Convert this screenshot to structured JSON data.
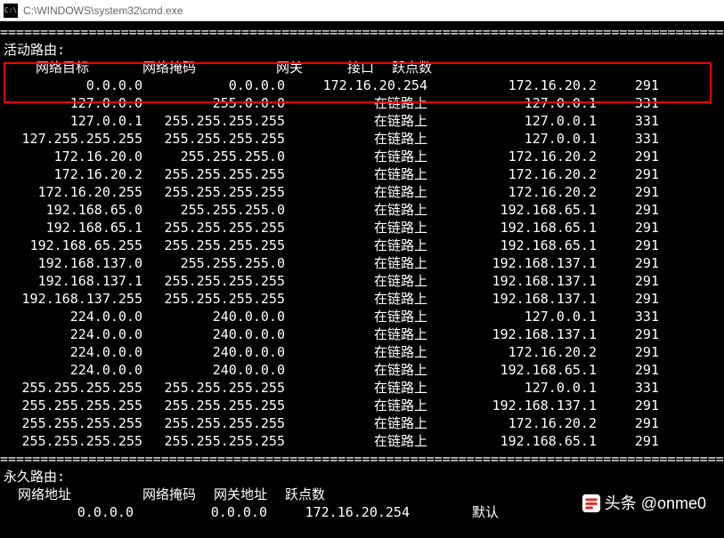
{
  "titlebar": {
    "icon_label": "C:\\",
    "path": "C:\\WINDOWS\\system32\\cmd.exe"
  },
  "separator": "===============================================================================================",
  "sections": {
    "active_routes_label": "活动路由:",
    "permanent_routes_label": "永久路由:"
  },
  "active_headers": {
    "dest": "网络目标",
    "mask": "网络掩码",
    "gateway": "网关",
    "iface": "接口",
    "metric": "跃点数"
  },
  "active_header_row": "网络目标        网络掩码          网关       接口    跃点数",
  "active_routes": [
    {
      "dest": "0.0.0.0",
      "mask": "0.0.0.0",
      "gateway": "172.16.20.254",
      "iface": "172.16.20.2",
      "metric": "291"
    },
    {
      "dest": "127.0.0.0",
      "mask": "255.0.0.0",
      "gateway": "在链路上",
      "iface": "127.0.0.1",
      "metric": "331"
    },
    {
      "dest": "127.0.0.1",
      "mask": "255.255.255.255",
      "gateway": "在链路上",
      "iface": "127.0.0.1",
      "metric": "331"
    },
    {
      "dest": "127.255.255.255",
      "mask": "255.255.255.255",
      "gateway": "在链路上",
      "iface": "127.0.0.1",
      "metric": "331"
    },
    {
      "dest": "172.16.20.0",
      "mask": "255.255.255.0",
      "gateway": "在链路上",
      "iface": "172.16.20.2",
      "metric": "291"
    },
    {
      "dest": "172.16.20.2",
      "mask": "255.255.255.255",
      "gateway": "在链路上",
      "iface": "172.16.20.2",
      "metric": "291"
    },
    {
      "dest": "172.16.20.255",
      "mask": "255.255.255.255",
      "gateway": "在链路上",
      "iface": "172.16.20.2",
      "metric": "291"
    },
    {
      "dest": "192.168.65.0",
      "mask": "255.255.255.0",
      "gateway": "在链路上",
      "iface": "192.168.65.1",
      "metric": "291"
    },
    {
      "dest": "192.168.65.1",
      "mask": "255.255.255.255",
      "gateway": "在链路上",
      "iface": "192.168.65.1",
      "metric": "291"
    },
    {
      "dest": "192.168.65.255",
      "mask": "255.255.255.255",
      "gateway": "在链路上",
      "iface": "192.168.65.1",
      "metric": "291"
    },
    {
      "dest": "192.168.137.0",
      "mask": "255.255.255.0",
      "gateway": "在链路上",
      "iface": "192.168.137.1",
      "metric": "291"
    },
    {
      "dest": "192.168.137.1",
      "mask": "255.255.255.255",
      "gateway": "在链路上",
      "iface": "192.168.137.1",
      "metric": "291"
    },
    {
      "dest": "192.168.137.255",
      "mask": "255.255.255.255",
      "gateway": "在链路上",
      "iface": "192.168.137.1",
      "metric": "291"
    },
    {
      "dest": "224.0.0.0",
      "mask": "240.0.0.0",
      "gateway": "在链路上",
      "iface": "127.0.0.1",
      "metric": "331"
    },
    {
      "dest": "224.0.0.0",
      "mask": "240.0.0.0",
      "gateway": "在链路上",
      "iface": "192.168.137.1",
      "metric": "291"
    },
    {
      "dest": "224.0.0.0",
      "mask": "240.0.0.0",
      "gateway": "在链路上",
      "iface": "172.16.20.2",
      "metric": "291"
    },
    {
      "dest": "224.0.0.0",
      "mask": "240.0.0.0",
      "gateway": "在链路上",
      "iface": "192.168.65.1",
      "metric": "291"
    },
    {
      "dest": "255.255.255.255",
      "mask": "255.255.255.255",
      "gateway": "在链路上",
      "iface": "127.0.0.1",
      "metric": "331"
    },
    {
      "dest": "255.255.255.255",
      "mask": "255.255.255.255",
      "gateway": "在链路上",
      "iface": "192.168.137.1",
      "metric": "291"
    },
    {
      "dest": "255.255.255.255",
      "mask": "255.255.255.255",
      "gateway": "在链路上",
      "iface": "172.16.20.2",
      "metric": "291"
    },
    {
      "dest": "255.255.255.255",
      "mask": "255.255.255.255",
      "gateway": "在链路上",
      "iface": "192.168.65.1",
      "metric": "291"
    }
  ],
  "perm_headers": {
    "addr": "网络地址",
    "mask": "网络掩码",
    "gw": "网关地址",
    "metric": "跃点数"
  },
  "perm_routes": [
    {
      "addr": "0.0.0.0",
      "mask": "0.0.0.0",
      "gw": "172.16.20.254",
      "metric": "默认"
    }
  ],
  "watermark": {
    "text": "头条 @onme0"
  }
}
